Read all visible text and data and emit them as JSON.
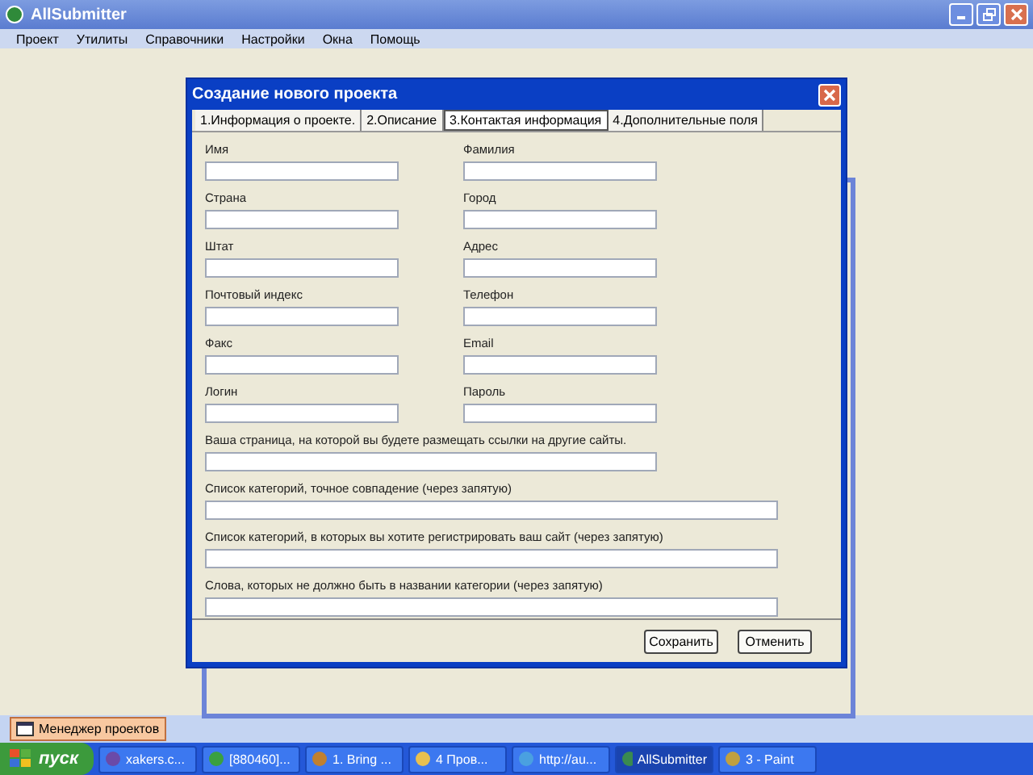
{
  "window": {
    "title": "AllSubmitter"
  },
  "menu": [
    "Проект",
    "Утилиты",
    "Справочники",
    "Настройки",
    "Окна",
    "Помощь"
  ],
  "dialog": {
    "title": "Создание нового проекта",
    "tabs": [
      {
        "label": "1.Информация о проекте.",
        "selected": false
      },
      {
        "label": "2.Описание",
        "selected": false
      },
      {
        "label": "3.Контактая информация",
        "selected": true
      },
      {
        "label": "4.Дополнительные поля",
        "selected": false
      }
    ],
    "fields": [
      {
        "label": "Имя",
        "kind": "short"
      },
      {
        "label": "Фамилия",
        "kind": "short"
      },
      {
        "label": "Страна",
        "kind": "short"
      },
      {
        "label": "Город",
        "kind": "short"
      },
      {
        "label": "Штат",
        "kind": "short"
      },
      {
        "label": "Адрес",
        "kind": "short"
      },
      {
        "label": "Почтовый индекс",
        "kind": "short"
      },
      {
        "label": "Телефон",
        "kind": "short"
      },
      {
        "label": "Факс",
        "kind": "short"
      },
      {
        "label": "Email",
        "kind": "short"
      },
      {
        "label": "Логин",
        "kind": "short"
      },
      {
        "label": "Пароль",
        "kind": "short"
      },
      {
        "label": "Ваша страница, на которой вы будете размещать ссылки на другие сайты.",
        "kind": "medium"
      },
      {
        "label": "Список категорий, точное совпадение (через запятую)",
        "kind": "long"
      },
      {
        "label": "Список категорий, в которых вы хотите регистрировать ваш сайт  (через запятую)",
        "kind": "long"
      },
      {
        "label": "Слова, которых не должно быть в названии категории (через запятую)",
        "kind": "long"
      }
    ],
    "buttons": [
      "Сохранить",
      "Отменить"
    ]
  },
  "bottom_panel": {
    "tabs": [
      {
        "label": "Менеджер проектов",
        "selected": true
      }
    ]
  },
  "taskbar": {
    "start": "пуск",
    "items": [
      {
        "label": "xakers.c...",
        "selected": false
      },
      {
        "label": "[880460]...",
        "selected": false
      },
      {
        "label": "1. Bring ...",
        "selected": false
      },
      {
        "label": "4 Пров...",
        "selected": false
      },
      {
        "label": "http://au...",
        "selected": false
      },
      {
        "label": "AllSubmitter",
        "selected": true
      },
      {
        "label": "3 - Paint",
        "selected": false
      }
    ]
  }
}
